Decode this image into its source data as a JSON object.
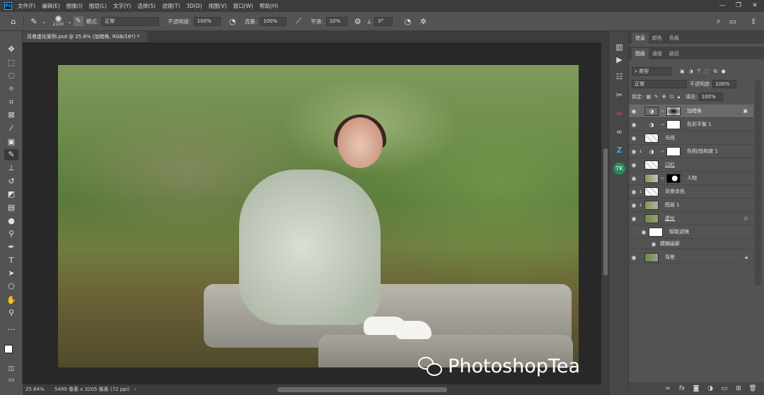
{
  "app": {
    "logo": "Ps",
    "menu": [
      "文件(F)",
      "编辑(E)",
      "图像(I)",
      "图层(L)",
      "文字(Y)",
      "选择(S)",
      "滤镜(T)",
      "3D(D)",
      "视图(V)",
      "窗口(W)",
      "帮助(H)"
    ]
  },
  "options": {
    "brush_size": "2100",
    "mode_label": "模式:",
    "mode_value": "正常",
    "opacity_label": "不透明度:",
    "opacity_value": "100%",
    "flow_label": "流量:",
    "flow_value": "100%",
    "smoothing_label": "平滑:",
    "smoothing_value": "10%",
    "angle_value": "0°"
  },
  "document": {
    "tab_title": "背景虚化案例.psd @ 25.8% (加暗角, RGB/16*) *",
    "zoom": "25.84%",
    "dimensions": "5499 像素 x 3205 像素 (72 ppi)"
  },
  "watermark": {
    "text": "PhotoshopTea"
  },
  "panels": {
    "top_tabs": [
      "信息",
      "颜色",
      "色板"
    ],
    "layer_tabs": [
      "图层",
      "通道",
      "路径"
    ],
    "filter_kind": "类型",
    "blend_mode": "正常",
    "opacity_label": "不透明度:",
    "opacity_value": "100%",
    "lock_label": "锁定:",
    "fill_label": "填充:",
    "fill_value": "100%"
  },
  "layers": [
    {
      "name": "加暗角",
      "selected": true
    },
    {
      "name": "色彩平衡 1",
      "selected": false
    },
    {
      "name": "光线",
      "selected": false
    },
    {
      "name": "色相/饱和度 1",
      "selected": false
    },
    {
      "name": "口红",
      "selected": false
    },
    {
      "name": "人物",
      "selected": false
    },
    {
      "name": "背景余色",
      "selected": false
    },
    {
      "name": "图层 1",
      "selected": false
    },
    {
      "name": "虚化",
      "selected": false
    },
    {
      "name": "智能滤镜",
      "selected": false
    },
    {
      "name": "模糊画廊",
      "selected": false
    },
    {
      "name": "背景",
      "selected": false
    }
  ]
}
